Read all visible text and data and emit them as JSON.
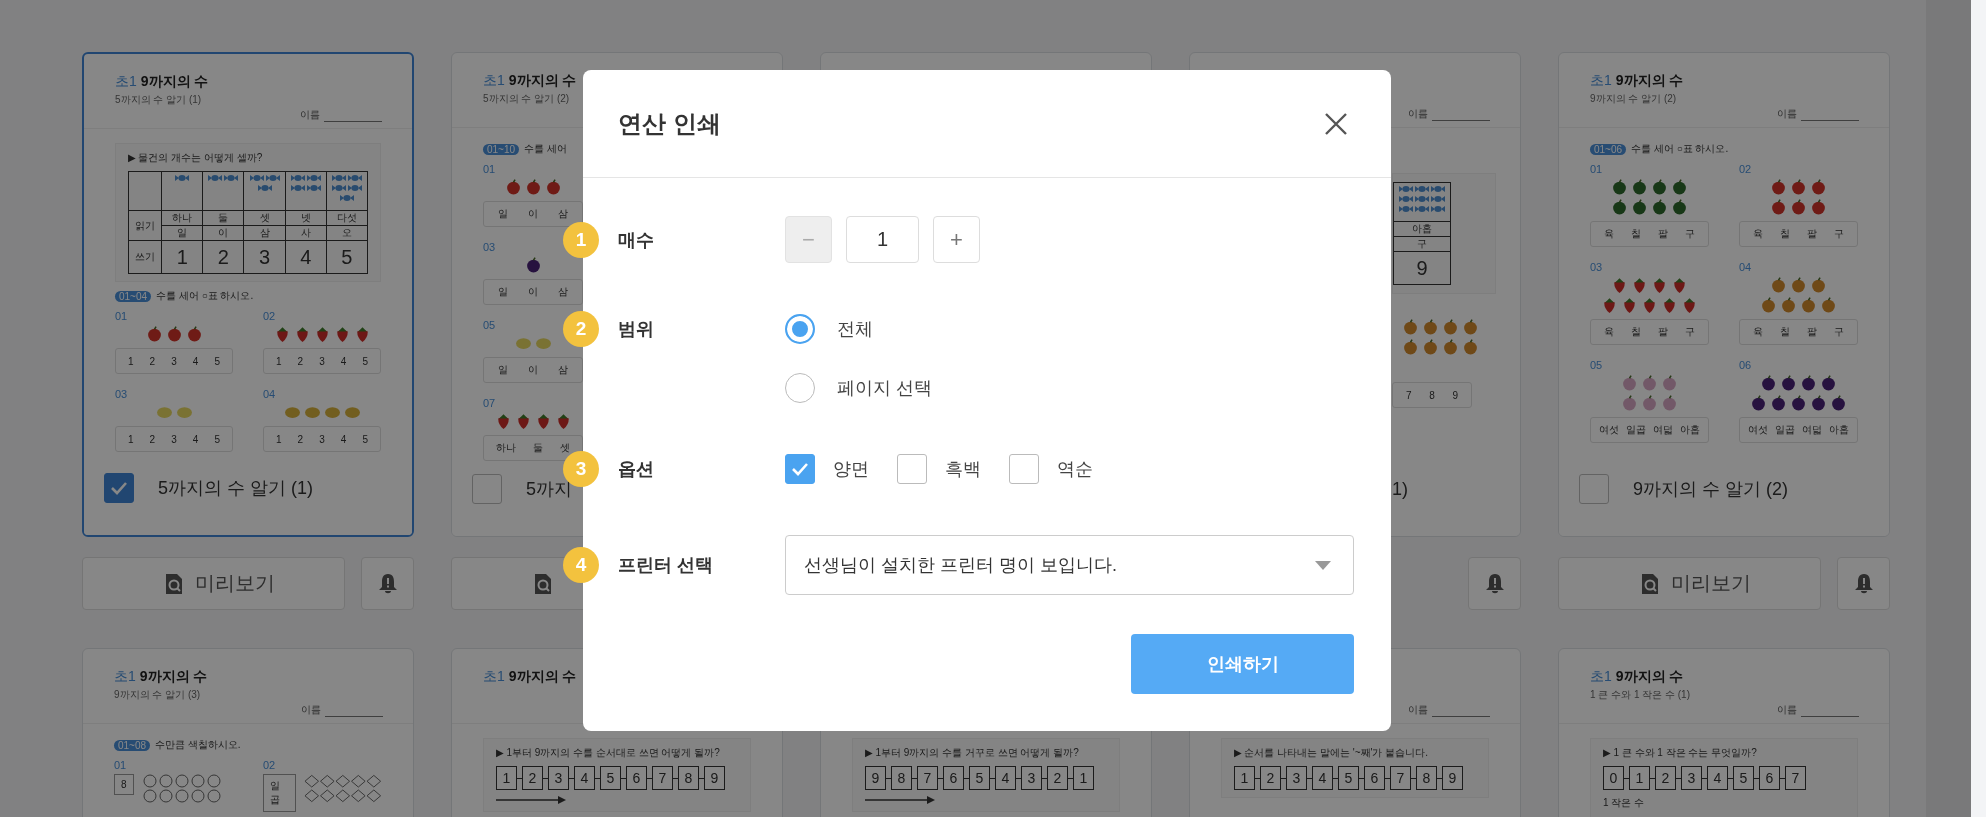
{
  "rows": [
    {
      "cards": [
        {
          "kind": "full",
          "selected": true,
          "header": {
            "grade": "초1",
            "title": "9까지의 수",
            "subtitle": "5까지의 수 알기 (1)",
            "name_label": "이름"
          },
          "blocks": [
            {
              "kind": "count_table",
              "question": "▶ 물건의 개수는 어떻게 셀까?",
              "read_label": "읽기",
              "write_label": "쓰기",
              "columns": [
                {
                  "icons": [
                    {
                      "kind": "candy"
                    }
                  ],
                  "native": "하나",
                  "sino": "일",
                  "digit": "1"
                },
                {
                  "icons": [
                    {
                      "kind": "candy"
                    },
                    {
                      "kind": "candy"
                    }
                  ],
                  "native": "둘",
                  "sino": "이",
                  "digit": "2"
                },
                {
                  "icons": [
                    {
                      "kind": "candy"
                    },
                    {
                      "kind": "candy"
                    },
                    {
                      "kind": "candy"
                    }
                  ],
                  "native": "셋",
                  "sino": "삼",
                  "digit": "3"
                },
                {
                  "icons": [
                    {
                      "kind": "candy"
                    },
                    {
                      "kind": "candy"
                    },
                    {
                      "kind": "candy"
                    },
                    {
                      "kind": "candy"
                    }
                  ],
                  "native": "넷",
                  "sino": "사",
                  "digit": "4"
                },
                {
                  "icons": [
                    {
                      "kind": "candy"
                    },
                    {
                      "kind": "candy"
                    },
                    {
                      "kind": "candy"
                    },
                    {
                      "kind": "candy"
                    },
                    {
                      "kind": "candy"
                    }
                  ],
                  "native": "다섯",
                  "sino": "오",
                  "digit": "5"
                }
              ]
            },
            {
              "kind": "instruction",
              "tag": "01~04",
              "text": "수를 세어 ○표 하시오."
            },
            {
              "kind": "problems",
              "items": [
                {
                  "number": "01",
                  "rows": [
                    [
                      {
                        "kind": "apple"
                      },
                      {
                        "kind": "apple"
                      },
                      {
                        "kind": "apple"
                      }
                    ]
                  ],
                  "choices": [
                    "1",
                    "2",
                    "3",
                    "4",
                    "5"
                  ]
                },
                {
                  "number": "02",
                  "rows": [
                    [
                      {
                        "kind": "strawberry"
                      },
                      {
                        "kind": "strawberry"
                      },
                      {
                        "kind": "strawberry"
                      },
                      {
                        "kind": "strawberry"
                      },
                      {
                        "kind": "strawberry"
                      }
                    ]
                  ],
                  "choices": [
                    "1",
                    "2",
                    "3",
                    "4",
                    "5"
                  ]
                },
                {
                  "number": "03",
                  "rows": [
                    [
                      {
                        "kind": "lemon"
                      },
                      {
                        "kind": "lemon"
                      }
                    ]
                  ],
                  "choices": [
                    "1",
                    "2",
                    "3",
                    "4",
                    "5"
                  ]
                },
                {
                  "number": "04",
                  "rows": [
                    [
                      {
                        "kind": "melon"
                      },
                      {
                        "kind": "melon"
                      },
                      {
                        "kind": "melon"
                      },
                      {
                        "kind": "melon"
                      }
                    ]
                  ],
                  "choices": [
                    "1",
                    "2",
                    "3",
                    "4",
                    "5"
                  ]
                }
              ]
            }
          ],
          "footer": {
            "label": "5까지의 수 알기 (1)",
            "checked": true
          },
          "actions": [
            {
              "kind": "preview",
              "label": "미리보기"
            },
            {
              "kind": "bell"
            }
          ]
        },
        {
          "kind": "left_part",
          "selected": false,
          "header": {
            "grade": "초1",
            "title": "9까지의 수",
            "subtitle": "5까지의 수 알기 (2)"
          },
          "blocks": [
            {
              "kind": "instruction",
              "tag": "01~10",
              "text": "수를 세어"
            },
            {
              "kind": "problems",
              "items": [
                {
                  "number": "01",
                  "rows": [
                    [
                      {
                        "kind": "apple"
                      },
                      {
                        "kind": "apple"
                      },
                      {
                        "kind": "apple"
                      }
                    ]
                  ],
                  "choices": [
                    "일",
                    "이",
                    "삼"
                  ]
                },
                {
                  "number": "03",
                  "rows": [
                    [
                      {
                        "kind": "grape"
                      }
                    ]
                  ],
                  "choices": [
                    "일",
                    "이",
                    "삼"
                  ]
                },
                {
                  "number": "05",
                  "rows": [
                    [
                      {
                        "kind": "lemon"
                      },
                      {
                        "kind": "lemon"
                      }
                    ]
                  ],
                  "choices": [
                    "일",
                    "이",
                    "삼"
                  ]
                },
                {
                  "number": "07",
                  "rows": [
                    [
                      {
                        "kind": "strawberry"
                      },
                      {
                        "kind": "strawberry"
                      },
                      {
                        "kind": "strawberry"
                      },
                      {
                        "kind": "strawberry"
                      }
                    ]
                  ],
                  "choices": [
                    "하나",
                    "둘",
                    "셋"
                  ]
                }
              ]
            }
          ],
          "footer": {
            "label": "5까지",
            "checked": false
          },
          "actions": [
            {
              "kind": "preview"
            }
          ]
        },
        {
          "kind": "hidden",
          "selected": false
        },
        {
          "kind": "right_part",
          "selected": false,
          "header": {
            "name_label": "이름"
          },
          "blocks": [
            {
              "kind": "table_fragment",
              "icons": [
                {
                  "kind": "candy"
                },
                {
                  "kind": "candy"
                },
                {
                  "kind": "candy"
                },
                {
                  "kind": "candy"
                },
                {
                  "kind": "candy"
                },
                {
                  "kind": "candy"
                },
                {
                  "kind": "candy"
                },
                {
                  "kind": "candy"
                },
                {
                  "kind": "candy"
                }
              ],
              "native": "아홉",
              "sino": "구",
              "digit": "9"
            },
            {
              "kind": "fruit_rows",
              "rows": [
                [
                  {
                    "kind": "pear"
                  },
                  {
                    "kind": "pear"
                  },
                  {
                    "kind": "pear"
                  },
                  {
                    "kind": "pear"
                  }
                ],
                [
                  {
                    "kind": "pear"
                  },
                  {
                    "kind": "pear"
                  },
                  {
                    "kind": "pear"
                  },
                  {
                    "kind": "pear"
                  }
                ]
              ]
            },
            {
              "kind": "choices",
              "items": [
                "7",
                "8",
                "9"
              ]
            }
          ],
          "footer": {
            "label": "1)"
          },
          "actions": [
            {
              "kind": "bell"
            }
          ]
        },
        {
          "kind": "full",
          "selected": false,
          "header": {
            "grade": "초1",
            "title": "9까지의 수",
            "subtitle": "9까지의 수 알기 (2)",
            "name_label": "이름"
          },
          "blocks": [
            {
              "kind": "instruction",
              "tag": "01~06",
              "text": "수를 세어 ○표 하시오."
            },
            {
              "kind": "problems",
              "items": [
                {
                  "number": "01",
                  "rows": [
                    [
                      {
                        "kind": "watermelon"
                      },
                      {
                        "kind": "watermelon"
                      },
                      {
                        "kind": "watermelon"
                      },
                      {
                        "kind": "watermelon"
                      }
                    ],
                    [
                      {
                        "kind": "watermelon"
                      },
                      {
                        "kind": "watermelon"
                      },
                      {
                        "kind": "watermelon"
                      },
                      {
                        "kind": "watermelon"
                      }
                    ]
                  ],
                  "choices": [
                    "육",
                    "칠",
                    "팔",
                    "구"
                  ]
                },
                {
                  "number": "02",
                  "rows": [
                    [
                      {
                        "kind": "apple"
                      },
                      {
                        "kind": "apple"
                      },
                      {
                        "kind": "apple"
                      }
                    ],
                    [
                      {
                        "kind": "apple"
                      },
                      {
                        "kind": "apple"
                      },
                      {
                        "kind": "apple"
                      }
                    ]
                  ],
                  "choices": [
                    "육",
                    "칠",
                    "팔",
                    "구"
                  ]
                },
                {
                  "number": "03",
                  "rows": [
                    [
                      {
                        "kind": "strawberry"
                      },
                      {
                        "kind": "strawberry"
                      },
                      {
                        "kind": "strawberry"
                      },
                      {
                        "kind": "strawberry"
                      }
                    ],
                    [
                      {
                        "kind": "strawberry"
                      },
                      {
                        "kind": "strawberry"
                      },
                      {
                        "kind": "strawberry"
                      },
                      {
                        "kind": "strawberry"
                      },
                      {
                        "kind": "strawberry"
                      }
                    ]
                  ],
                  "choices": [
                    "육",
                    "칠",
                    "팔",
                    "구"
                  ]
                },
                {
                  "number": "04",
                  "rows": [
                    [
                      {
                        "kind": "pear"
                      },
                      {
                        "kind": "pear"
                      },
                      {
                        "kind": "pear"
                      }
                    ],
                    [
                      {
                        "kind": "pear"
                      },
                      {
                        "kind": "pear"
                      },
                      {
                        "kind": "pear"
                      },
                      {
                        "kind": "pear"
                      }
                    ]
                  ],
                  "choices": [
                    "육",
                    "칠",
                    "팔",
                    "구"
                  ]
                },
                {
                  "number": "05",
                  "rows": [
                    [
                      {
                        "kind": "onion"
                      },
                      {
                        "kind": "onion"
                      },
                      {
                        "kind": "onion"
                      }
                    ],
                    [
                      {
                        "kind": "onion"
                      },
                      {
                        "kind": "onion"
                      },
                      {
                        "kind": "onion"
                      }
                    ]
                  ],
                  "choices": [
                    "여섯",
                    "일곱",
                    "여덟",
                    "아홉"
                  ]
                },
                {
                  "number": "06",
                  "rows": [
                    [
                      {
                        "kind": "grape"
                      },
                      {
                        "kind": "grape"
                      },
                      {
                        "kind": "grape"
                      },
                      {
                        "kind": "grape"
                      }
                    ],
                    [
                      {
                        "kind": "grape"
                      },
                      {
                        "kind": "grape"
                      },
                      {
                        "kind": "grape"
                      },
                      {
                        "kind": "grape"
                      },
                      {
                        "kind": "grape"
                      }
                    ]
                  ],
                  "choices": [
                    "여섯",
                    "일곱",
                    "여덟",
                    "아홉"
                  ]
                }
              ]
            }
          ],
          "footer": {
            "label": "9까지의 수 알기 (2)",
            "checked": false
          },
          "actions": [
            {
              "kind": "preview",
              "label": "미리보기"
            },
            {
              "kind": "bell"
            }
          ]
        }
      ]
    },
    {
      "cards": [
        {
          "kind": "full",
          "selected": false,
          "header": {
            "grade": "초1",
            "title": "9까지의 수",
            "subtitle": "9까지의 수 알기 (3)",
            "name_label": "이름"
          },
          "blocks": [
            {
              "kind": "instruction",
              "tag": "01~08",
              "text": "수만큼 색칠하시오."
            },
            {
              "kind": "shade_problems",
              "items": [
                {
                  "number": "01",
                  "prompt": "8",
                  "kind": "circle"
                },
                {
                  "number": "02",
                  "prompt": "일곱",
                  "kind": "diamond"
                }
              ]
            }
          ]
        },
        {
          "kind": "full",
          "selected": false,
          "header": {
            "grade": "초1",
            "title": "9까지의 수"
          },
          "blocks": [
            {
              "kind": "sequence",
              "question": "▶ 1부터 9까지의 수를 순서대로 쓰면 어떻게 될까?",
              "items": [
                "1",
                "2",
                "3",
                "4",
                "5",
                "6",
                "7",
                "8",
                "9"
              ],
              "arrow": true
            }
          ]
        },
        {
          "kind": "full",
          "selected": false,
          "blocks": [
            {
              "kind": "sequence",
              "question": "▶ 1부터 9까지의 수를 거꾸로 쓰면 어떻게 될까?",
              "items": [
                "9",
                "8",
                "7",
                "6",
                "5",
                "4",
                "3",
                "2",
                "1"
              ],
              "arrow": true
            }
          ]
        },
        {
          "kind": "full",
          "selected": false,
          "header": {
            "name_label": "이름"
          },
          "blocks": [
            {
              "kind": "sequence",
              "question": "▶ 순서를 나타내는 말에는 '~째'가 붙습니다.",
              "items": [
                "1",
                "2",
                "3",
                "4",
                "5",
                "6",
                "7",
                "8",
                "9"
              ]
            }
          ]
        },
        {
          "kind": "full",
          "selected": false,
          "header": {
            "grade": "초1",
            "title": "9까지의 수",
            "subtitle": "1 큰 수와 1 작은 수 (1)",
            "name_label": "이름"
          },
          "blocks": [
            {
              "kind": "sequence",
              "question": "▶ 1 큰 수와 1 작은 수는 무엇일까?",
              "items": [
                "0",
                "1",
                "2",
                "3",
                "4",
                "5",
                "6",
                "7"
              ],
              "below_label": "1 작은 수"
            }
          ]
        }
      ]
    }
  ],
  "dialog": {
    "title": "연산 인쇄",
    "rows": [
      {
        "kind": "stepper",
        "badge": "1",
        "label": "매수",
        "minus": "−",
        "value": "1",
        "plus": "+",
        "minus_disabled": true
      },
      {
        "kind": "radio",
        "badge": "2",
        "label": "범위",
        "options": [
          {
            "label": "전체",
            "selected": true
          },
          {
            "label": "페이지 선택",
            "selected": false
          }
        ]
      },
      {
        "kind": "checkbox",
        "badge": "3",
        "label": "옵션",
        "options": [
          {
            "label": "양면",
            "checked": true
          },
          {
            "label": "흑백",
            "checked": false
          },
          {
            "label": "역순",
            "checked": false
          }
        ]
      },
      {
        "kind": "select",
        "badge": "4",
        "label": "프린터 선택",
        "value": "선생님이 설치한 프린터 명이 보입니다."
      }
    ],
    "submit": "인쇄하기"
  }
}
